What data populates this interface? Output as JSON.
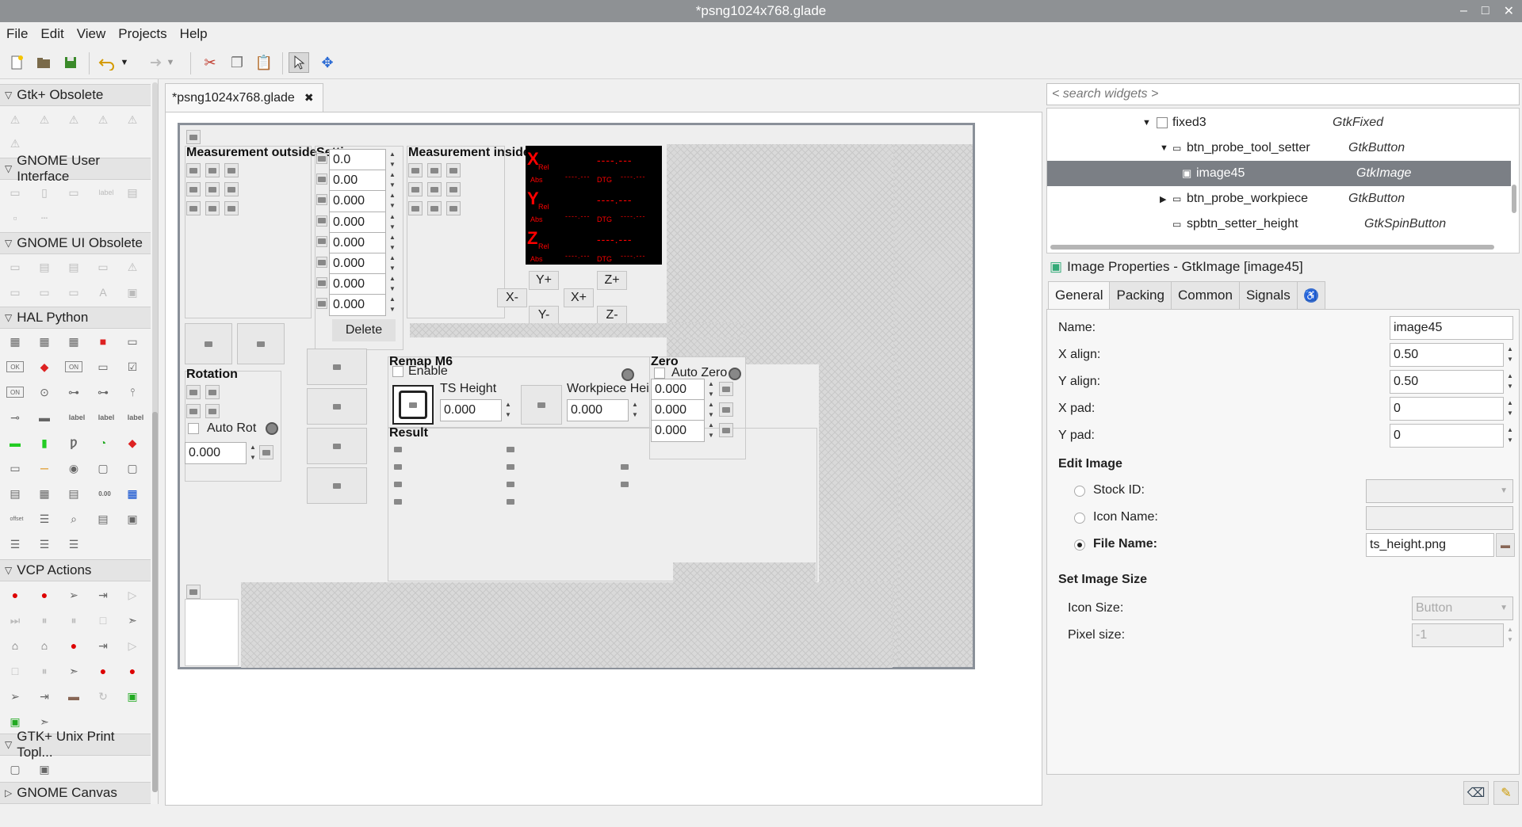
{
  "window": {
    "title": "*psng1024x768.glade",
    "controls": [
      "–",
      "□",
      "✕"
    ]
  },
  "menu": [
    "File",
    "Edit",
    "View",
    "Projects",
    "Help"
  ],
  "palette": {
    "groups": [
      {
        "label": "Gtk+ Obsolete"
      },
      {
        "label": "GNOME User Interface"
      },
      {
        "label": "GNOME UI Obsolete"
      },
      {
        "label": "HAL Python"
      },
      {
        "label": "VCP Actions"
      },
      {
        "label": "GTK+ Unix Print Topl..."
      },
      {
        "label": "GNOME Canvas"
      }
    ],
    "hal_icon_labels": [
      "OK",
      "ON",
      "ON",
      "label",
      "label",
      "label",
      "0.00",
      "offset",
      "label"
    ]
  },
  "editor_tab": {
    "label": "*psng1024x768.glade"
  },
  "design": {
    "measurement_outside": "Measurement outside",
    "settings": "Settings",
    "measurement_inside": "Measurement inside",
    "setting_values": [
      "0.0",
      "0.00",
      "0.000",
      "0.000",
      "0.000",
      "0.000",
      "0.000",
      "0.000"
    ],
    "delete": "Delete",
    "rotation": "Rotation",
    "auto_rot": "Auto Rot",
    "rot_value": "0.000",
    "remap_m6": "Remap M6",
    "enable": "Enable",
    "ts_height": "TS Height",
    "ts_height_value": "0.000",
    "workpiece_height": "Workpiece Heig",
    "workpiece_value": "0.000",
    "zero": "Zero",
    "auto_zero": "Auto Zero",
    "zero_values": [
      "0.000",
      "0.000",
      "0.000"
    ],
    "result": "Result",
    "jog": {
      "yplus": "Y+",
      "yminus": "Y-",
      "xminus": "X-",
      "xplus": "X+",
      "zplus": "Z+",
      "zminus": "Z-"
    },
    "dro": {
      "x": "X",
      "y": "Y",
      "z": "Z",
      "rel": "Rel",
      "abs": "Abs",
      "dtg": "DTG"
    }
  },
  "search": {
    "placeholder": "< search widgets >"
  },
  "tree": [
    {
      "name": "fixed3",
      "type": "GtkFixed"
    },
    {
      "name": "btn_probe_tool_setter",
      "type": "GtkButton"
    },
    {
      "name": "image45",
      "type": "GtkImage",
      "selected": true
    },
    {
      "name": "btn_probe_workpiece",
      "type": "GtkButton"
    },
    {
      "name": "spbtn_setter_height",
      "type": "GtkSpinButton"
    }
  ],
  "properties": {
    "header": "Image Properties - GtkImage [image45]",
    "tabs": [
      "General",
      "Packing",
      "Common",
      "Signals"
    ],
    "name_label": "Name:",
    "name_value": "image45",
    "xalign_label": "X align:",
    "xalign_value": "0.50",
    "yalign_label": "Y align:",
    "yalign_value": "0.50",
    "xpad_label": "X pad:",
    "xpad_value": "0",
    "ypad_label": "Y pad:",
    "ypad_value": "0",
    "edit_image": "Edit Image",
    "stock_id": "Stock ID:",
    "icon_name": "Icon Name:",
    "file_name": "File Name:",
    "file_value": "ts_height.png",
    "set_image_size": "Set Image Size",
    "icon_size": "Icon Size:",
    "icon_size_value": "Button",
    "pixel_size": "Pixel size:",
    "pixel_size_value": "-1"
  },
  "colors": {
    "selected_row": "#7b7f85",
    "dro_text": "#ff0000",
    "title_bg": "#8e9194"
  }
}
